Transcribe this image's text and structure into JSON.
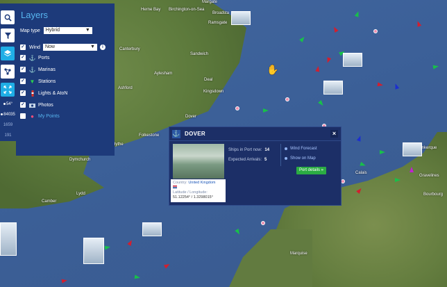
{
  "layers": {
    "title": "Layers",
    "map_type_label": "Map type",
    "map_type_value": "Hybrid",
    "wind_label": "Wind",
    "wind_value": "Now",
    "items": [
      {
        "label": "Ports",
        "checked": true,
        "icon": "anchor-icon"
      },
      {
        "label": "Marinas",
        "checked": true,
        "icon": "marina-icon"
      },
      {
        "label": "Stations",
        "checked": true,
        "icon": "antenna-icon"
      },
      {
        "label": "Lights & AtoN",
        "checked": true,
        "icon": "lighthouse-icon"
      },
      {
        "label": "Photos",
        "checked": true,
        "icon": "camera-icon"
      },
      {
        "label": "My Points",
        "checked": false,
        "icon": "pin-icon"
      }
    ]
  },
  "toolbar": {
    "buttons": [
      "search-icon",
      "filter-icon",
      "layers-icon",
      "network-icon",
      "fullscreen-icon"
    ],
    "stats": [
      "54°",
      "84035",
      "1659",
      "191"
    ]
  },
  "popup": {
    "title": "DOVER",
    "country_label": "Country:",
    "country_value": "United Kingdom",
    "latlon_label": "Latitude / Longitude:",
    "latlon_value": "51.12254° / 1.3298015°",
    "ships_in_port_label": "Ships in Port now:",
    "ships_in_port_value": "14",
    "expected_arrivals_label": "Expected Arrivals:",
    "expected_arrivals_value": "5",
    "wind_forecast_link": "Wind Forecast",
    "show_on_map_link": "Show on Map",
    "port_details_button": "Port details »",
    "close_symbol": "×"
  },
  "map": {
    "cities": [
      "Margate",
      "Broadsta",
      "Ramsgate",
      "Herne Bay",
      "Birchington-on-Sea",
      "Canterbury",
      "Sandwich",
      "Ashford",
      "Aylesham",
      "Deal",
      "Kingsdown",
      "Folkestone",
      "Dover",
      "Hythe",
      "Dymchurch",
      "Lydd",
      "Camber",
      "Gravelines",
      "Calais",
      "Bourbourg",
      "Marquise",
      "Dunkerque"
    ]
  }
}
